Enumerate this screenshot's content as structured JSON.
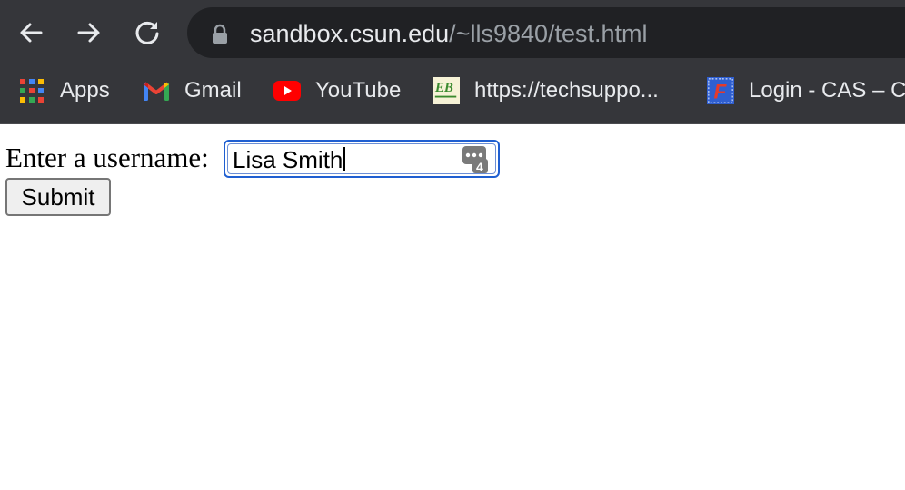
{
  "browser": {
    "url_host": "sandbox.csun.edu",
    "url_path": "/~lls9840/test.html",
    "nav_icons": [
      "back-arrow-icon",
      "forward-arrow-icon",
      "reload-icon",
      "lock-icon"
    ],
    "bookmarks": [
      {
        "label": "Apps",
        "icon": "apps-grid-icon"
      },
      {
        "label": "Gmail",
        "icon": "gmail-icon"
      },
      {
        "label": "YouTube",
        "icon": "youtube-icon"
      },
      {
        "label": "https://techsuppo...",
        "icon": "eb-icon",
        "icon_text": "EB"
      },
      {
        "label": "Login - CAS – C",
        "icon": "cas-login-icon",
        "icon_text": "F"
      }
    ]
  },
  "page": {
    "username_label": "Enter a username:",
    "username_value": "Lisa Smith",
    "password_manager_badge": "4",
    "submit_label": "Submit"
  },
  "colors": {
    "chrome_bg": "#35363a",
    "omnibox_bg": "#202124",
    "focus_ring": "#1f5fd1"
  }
}
